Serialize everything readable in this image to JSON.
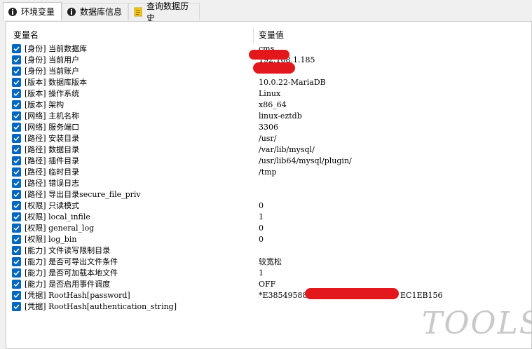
{
  "tabs": [
    {
      "label": "环境变量",
      "icon": "info-circle-icon"
    },
    {
      "label": "数据库信息",
      "icon": "info-circle-icon"
    },
    {
      "label": "查询数据历史",
      "icon": "notes-icon"
    }
  ],
  "grid": {
    "col_name": "变量名",
    "col_value": "变量值",
    "rows": [
      {
        "name": "[身份] 当前数据库",
        "value": "cms",
        "checked": true
      },
      {
        "name": "[身份] 当前用户",
        "value": "192.168.1.185",
        "checked": true
      },
      {
        "name": "[身份] 当前账户",
        "value": "%",
        "checked": true
      },
      {
        "name": "[版本] 数据库版本",
        "value": "10.0.22-MariaDB",
        "checked": true
      },
      {
        "name": "[版本] 操作系统",
        "value": "Linux",
        "checked": true
      },
      {
        "name": "[版本] 架构",
        "value": "x86_64",
        "checked": true
      },
      {
        "name": "[网络] 主机名称",
        "value": "linux-eztdb",
        "checked": true
      },
      {
        "name": "[网络] 服务端口",
        "value": "3306",
        "checked": true
      },
      {
        "name": "[路径] 安装目录",
        "value": "/usr/",
        "checked": true
      },
      {
        "name": "[路径] 数据目录",
        "value": "/var/lib/mysql/",
        "checked": true
      },
      {
        "name": "[路径] 插件目录",
        "value": "/usr/lib64/mysql/plugin/",
        "checked": true
      },
      {
        "name": "[路径] 临时目录",
        "value": "/tmp",
        "checked": true
      },
      {
        "name": "[路径] 错误日志",
        "value": "",
        "checked": true
      },
      {
        "name": "[路径] 导出目录secure_file_priv",
        "value": "",
        "checked": true
      },
      {
        "name": "[权限] 只读模式",
        "value": "0",
        "checked": true
      },
      {
        "name": "[权限] local_infile",
        "value": "1",
        "checked": true
      },
      {
        "name": "[权限] general_log",
        "value": "0",
        "checked": true
      },
      {
        "name": "[权限] log_bin",
        "value": "0",
        "checked": true
      },
      {
        "name": "[能力] 文件读写限制目录",
        "value": "",
        "checked": true
      },
      {
        "name": "[能力] 是否可导出文件条件",
        "value": "较宽松",
        "checked": true
      },
      {
        "name": "[能力] 是否可加载本地文件",
        "value": "1",
        "checked": true
      },
      {
        "name": "[能力] 是否启用事件调度",
        "value": "OFF",
        "checked": true
      },
      {
        "name": "[凭据] RootHash[password]",
        "value": "*E38549588",
        "value_tail": "EC1EB156",
        "checked": true
      },
      {
        "name": "[凭据] RootHash[authentication_string]",
        "value": "",
        "checked": true
      }
    ]
  },
  "watermark": "TOOLS",
  "colors": {
    "checkbox": "#0067c0",
    "redaction": "#e3181d"
  }
}
